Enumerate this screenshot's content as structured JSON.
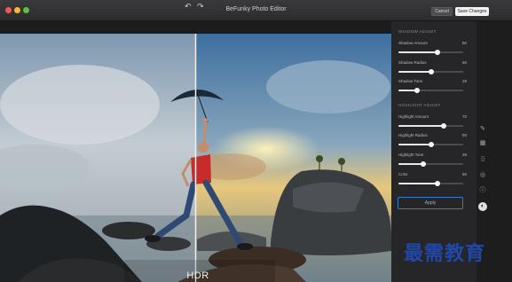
{
  "window": {
    "title": "BeFunky Photo Editor"
  },
  "titlebar": {
    "cancel_label": "Cancel",
    "save_label": "Save Changes"
  },
  "toolbar": {
    "undo_icon": "undo-icon",
    "redo_icon": "redo-icon"
  },
  "canvas": {
    "overlay_label": "HDR"
  },
  "panel": {
    "shadow_title": "SHADOW ADJUST",
    "highlight_title": "HIGHLIGHT ADJUST",
    "sliders": [
      {
        "label": "Shadow Amount",
        "value": "60",
        "level": 0.6
      },
      {
        "label": "Shadow Radius",
        "value": "50",
        "level": 0.5
      },
      {
        "label": "Shadow Tone",
        "value": "29",
        "level": 0.29
      },
      {
        "label": "Highlight Amount",
        "value": "70",
        "level": 0.7
      },
      {
        "label": "Highlight Radius",
        "value": "50",
        "level": 0.5
      },
      {
        "label": "Highlight Tone",
        "value": "39",
        "level": 0.39
      },
      {
        "label": "Color",
        "value": "60",
        "level": 0.6
      }
    ],
    "apply_label": "Apply"
  },
  "rail": {
    "icons": [
      "wand-icon",
      "grid-icon",
      "phone-icon",
      "eye-icon",
      "info-icon",
      "contrast-icon"
    ],
    "active_icon": "contrast-icon"
  },
  "watermark": {
    "text": "最需教育"
  },
  "colors": {
    "accent": "#3c7cc2",
    "panel": "#262628",
    "titlebar": "#2f2f31"
  }
}
